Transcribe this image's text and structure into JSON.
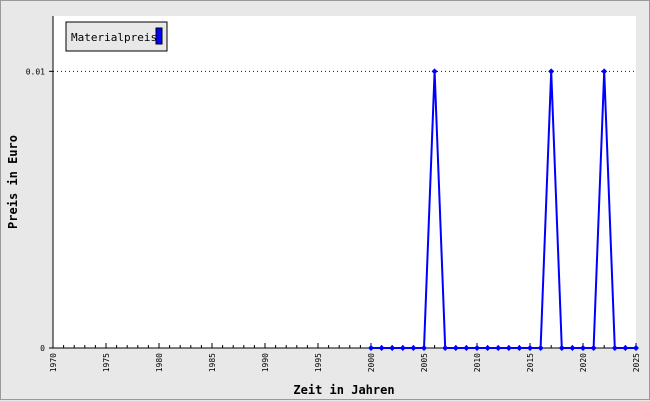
{
  "chart_data": {
    "type": "line",
    "xlabel": "Zeit in Jahren",
    "ylabel": "Preis in Euro",
    "xlim": [
      1970,
      2025
    ],
    "ylim": [
      0,
      0.012
    ],
    "x_ticks": [
      1970,
      1975,
      1980,
      1985,
      1990,
      1995,
      2000,
      2005,
      2010,
      2015,
      2020,
      2025
    ],
    "y_ticks": [
      0,
      0.01
    ],
    "y_tick_labels": [
      "0",
      "0.01"
    ],
    "grid": "dotted horizontal line at 0.01",
    "legend_position": "top-left",
    "colors": {
      "series": "#0000ff",
      "plot_bg": "#ffffff",
      "frame_bg": "#e8e8e8",
      "grid": "#0000aa"
    },
    "series": [
      {
        "name": "Materialpreis",
        "x": [
          2000,
          2001,
          2002,
          2003,
          2004,
          2005,
          2006,
          2007,
          2008,
          2009,
          2010,
          2011,
          2012,
          2013,
          2014,
          2015,
          2016,
          2017,
          2018,
          2019,
          2020,
          2021,
          2022,
          2023,
          2024,
          2025
        ],
        "values": [
          0,
          0,
          0,
          0,
          0,
          0,
          0.01,
          0,
          0,
          0,
          0,
          0,
          0,
          0,
          0,
          0,
          0,
          0.01,
          0,
          0,
          0,
          0,
          0.01,
          0,
          0,
          0
        ]
      }
    ]
  }
}
